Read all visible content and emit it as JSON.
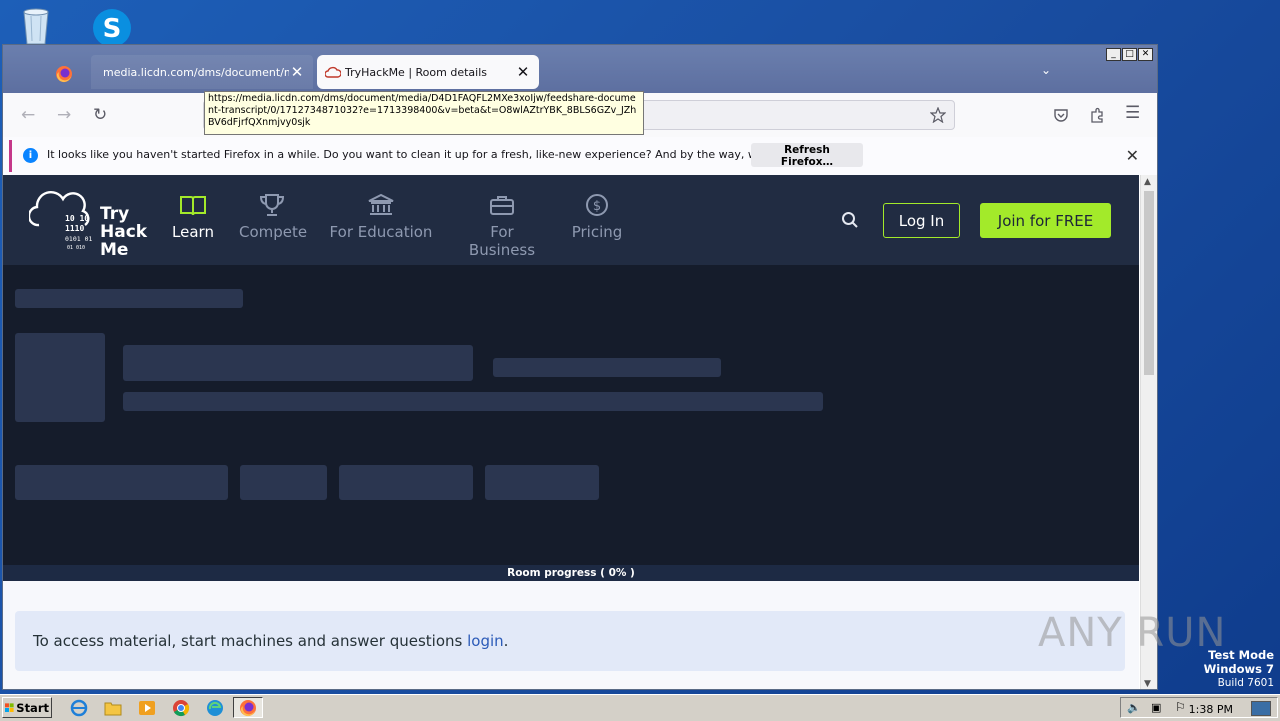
{
  "desktop": {
    "icons": [
      "recycle-bin-icon",
      "skype-icon"
    ],
    "test_mode": "Test Mode",
    "os": "Windows 7",
    "build": "Build 7601",
    "watermark": "ANY RUN"
  },
  "browser": {
    "tabs": [
      {
        "title": "media.licdn.com/dms/document/media/",
        "close": "✕"
      },
      {
        "title": "TryHackMe | Room details",
        "close": "✕"
      }
    ],
    "url_tooltip": "https://media.licdn.com/dms/document/media/D4D1FAQFL2MXe3xoIjw/feedshare-document-transcript/0/1712734871032?e=1713398400&v=beta&t=O8wlAZtrYBK_8BLS6GZv_JZhBV6dFjrfQXnmjvy0sjk",
    "notification": {
      "message": "It looks like you haven't started Firefox in a while. Do you want to clean it up for a fresh, like-new experience? And by the way, welcome back!",
      "button": "Refresh Firefox…"
    }
  },
  "site": {
    "logo_text": [
      "Try",
      "Hack",
      "Me"
    ],
    "nav": [
      {
        "label": "Learn",
        "icon": "book-icon"
      },
      {
        "label": "Compete",
        "icon": "trophy-icon"
      },
      {
        "label": "For Education",
        "icon": "building-icon"
      },
      {
        "label": "For Business",
        "icon": "briefcase-icon"
      },
      {
        "label": "Pricing",
        "icon": "dollar-icon"
      }
    ],
    "login": "Log In",
    "join": "Join for FREE",
    "progress": "Room progress ( 0% )",
    "access_text": "To access material, start machines and answer questions ",
    "access_link": "login",
    "access_end": "."
  },
  "taskbar": {
    "start": "Start",
    "clock": "1:38 PM"
  },
  "colors": {
    "thm_nav": "#212c42",
    "thm_green": "#a3ea2a",
    "hero_bg": "#151c2b"
  }
}
